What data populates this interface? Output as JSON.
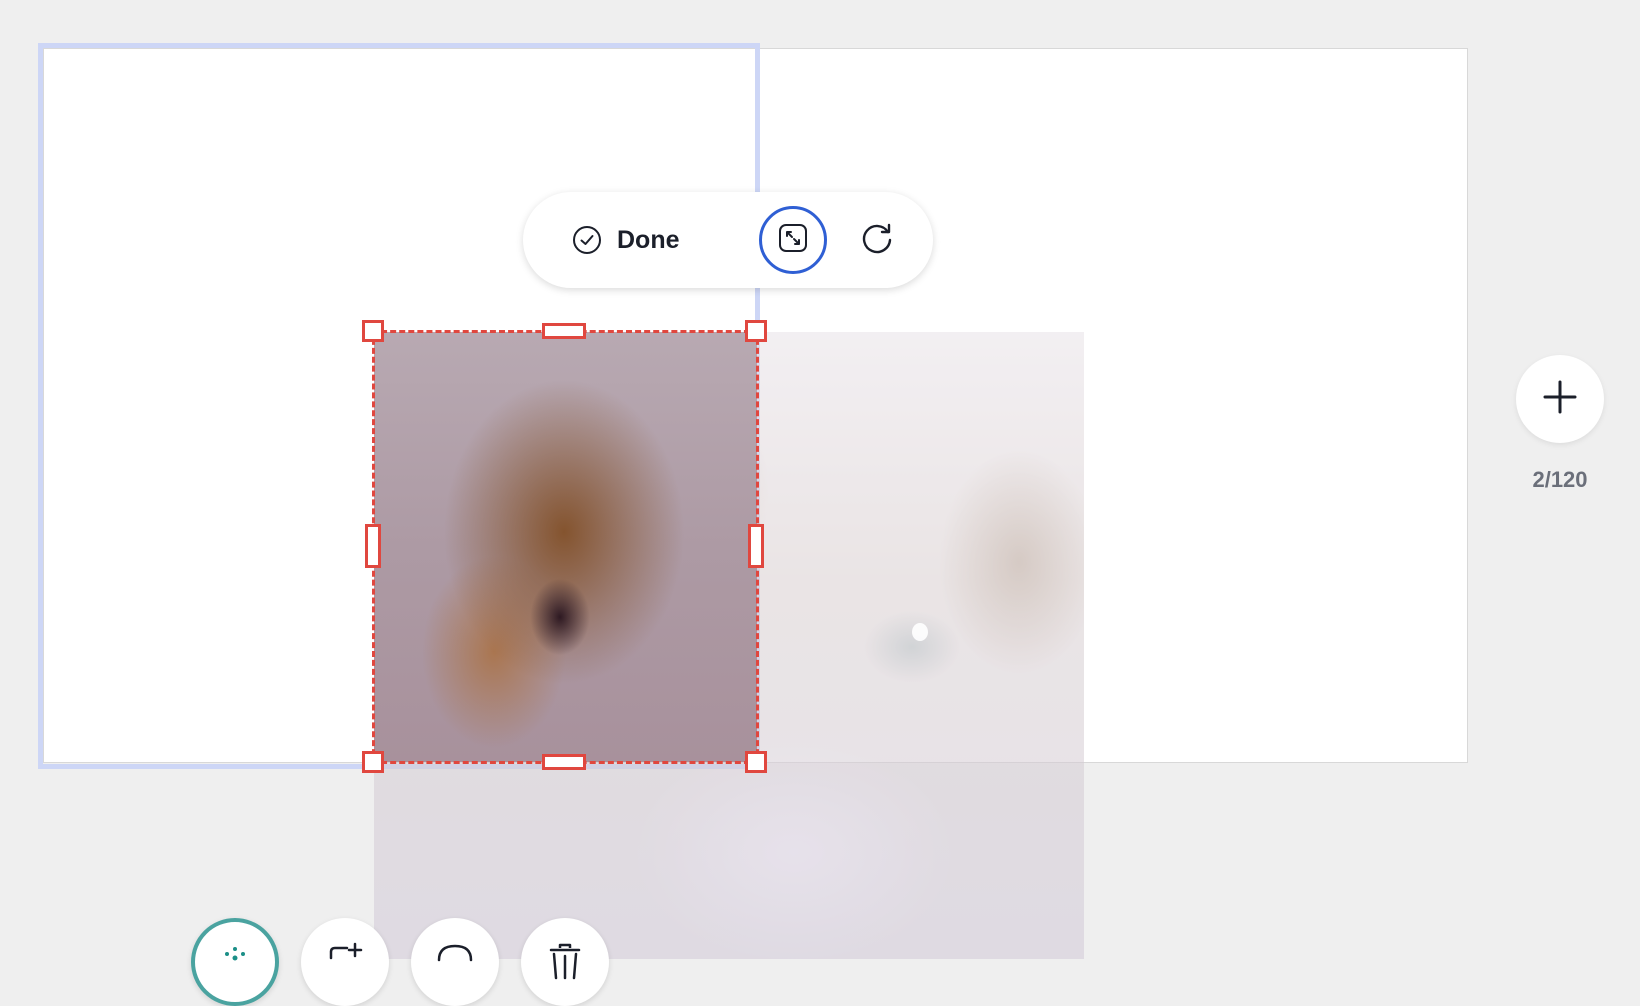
{
  "toolbar": {
    "done_label": "Done",
    "icons": {
      "done": "check-circle-icon",
      "crop_fit": "crop-fit-icon",
      "reset": "rotate-icon"
    },
    "accent_color": "#2f5fd4"
  },
  "side": {
    "add_icon": "plus-icon",
    "page_count": "2/120"
  },
  "bottom_actions": [
    {
      "icon": "magic-icon"
    },
    {
      "icon": "add-page-icon"
    },
    {
      "icon": "comment-icon"
    },
    {
      "icon": "trash-icon"
    }
  ],
  "colors": {
    "crop_border": "#e0473f",
    "selection": "#cdd6f6",
    "background": "#efefef"
  }
}
